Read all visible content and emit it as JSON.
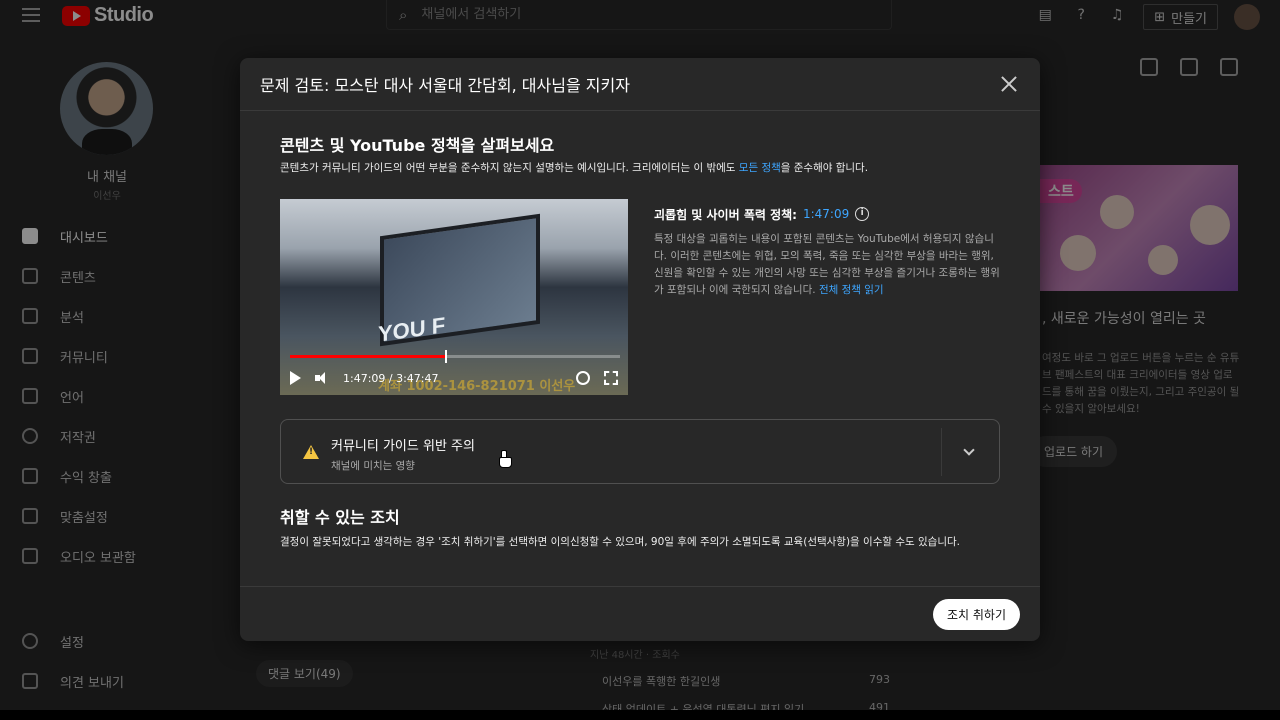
{
  "app": {
    "logo_text": "Studio",
    "search_placeholder": "채널에서 검색하기",
    "create_label": "만들기"
  },
  "sidebar": {
    "channel_name": "내 채널",
    "channel_sub": "이선우",
    "items": [
      {
        "label": "대시보드",
        "icon": "dashboard-icon"
      },
      {
        "label": "콘텐츠",
        "icon": "content-icon"
      },
      {
        "label": "분석",
        "icon": "analytics-icon"
      },
      {
        "label": "커뮤니티",
        "icon": "community-icon"
      },
      {
        "label": "언어",
        "icon": "subtitles-icon"
      },
      {
        "label": "저작권",
        "icon": "copyright-icon"
      },
      {
        "label": "수익 창출",
        "icon": "dollar-icon"
      },
      {
        "label": "맞춤설정",
        "icon": "customization-icon"
      },
      {
        "label": "오디오 보관함",
        "icon": "audio-library-icon"
      }
    ],
    "bottom_items": [
      {
        "label": "설정",
        "icon": "gear-icon"
      },
      {
        "label": "의견 보내기",
        "icon": "feedback-icon"
      }
    ]
  },
  "background": {
    "card_tag": "스트",
    "card_title": ", 새로운 가능성이 열리는 곳",
    "card_body": "여정도 바로 그 업로드 버튼을 누르는 순 유튜브 팬페스트의 대표 크리에이터들 영상 업로드를 통해 꿈을 이뤘는지, 그리고 주인공이 될 수 있을지 알아보세요!",
    "upload_label": "업로드 하기",
    "comments_label": "댓글 보기(49)",
    "list_meta": "지난 48시간 · 조회수",
    "list_rows": [
      {
        "title": "이선우를 폭행한 한길인생",
        "count": "793"
      },
      {
        "title": "상태 업데이트 + 윤석열 대통령님 편지 읽기",
        "count": "491"
      }
    ]
  },
  "dialog": {
    "title": "문제 검토: 모스탄 대사 서울대 간담회, 대사님을 지키자",
    "section_title": "콘텐츠 및 YouTube 정책을 살펴보세요",
    "section_desc_before": "콘텐츠가 커뮤니티 가이드의 어떤 부분을 준수하지 않는지 설명하는 예시입니다. 크리에이터는 이 밖에도 ",
    "section_desc_link": "모든 정책",
    "section_desc_after": "을 준수해야 합니다.",
    "video": {
      "screen_text": "YOU F",
      "watermark": "계좌 1002-146-821071 이선우",
      "current_time": "1:47:09",
      "duration": "3:47:47",
      "timecode": "1:47:09 / 3:47:47",
      "progress": 0.47
    },
    "policy": {
      "title": "괴롭힘 및 사이버 폭력 정책: ",
      "timestamp": "1:47:09",
      "text": "특정 대상을 괴롭히는 내용이 포함된 콘텐츠는 YouTube에서 허용되지 않습니다. 이러한 콘텐츠에는 위협, 모의 폭력, 죽음 또는 심각한 부상을 바라는 행위, 신원을 확인할 수 있는 개인의 사망 또는 심각한 부상을 즐기거나 조롱하는 행위가 포함되나 이에 국한되지 않습니다. ",
      "link": "전체 정책 읽기"
    },
    "accordion": {
      "title": "커뮤니티 가이드 위반 주의",
      "subtitle": "채널에 미치는 영향"
    },
    "actions_title": "취할 수 있는 조치",
    "actions_desc": "결정이 잘못되었다고 생각하는 경우 '조치 취하기'를 선택하면 이의신청할 수 있으며, 90일 후에 주의가 소멸되도록 교육(선택사항)을 이수할 수도 있습니다.",
    "action_button": "조치 취하기"
  },
  "colors": {
    "accent_link": "#3ea6ff",
    "progress": "#ff0000",
    "warning": "#f4c542"
  }
}
